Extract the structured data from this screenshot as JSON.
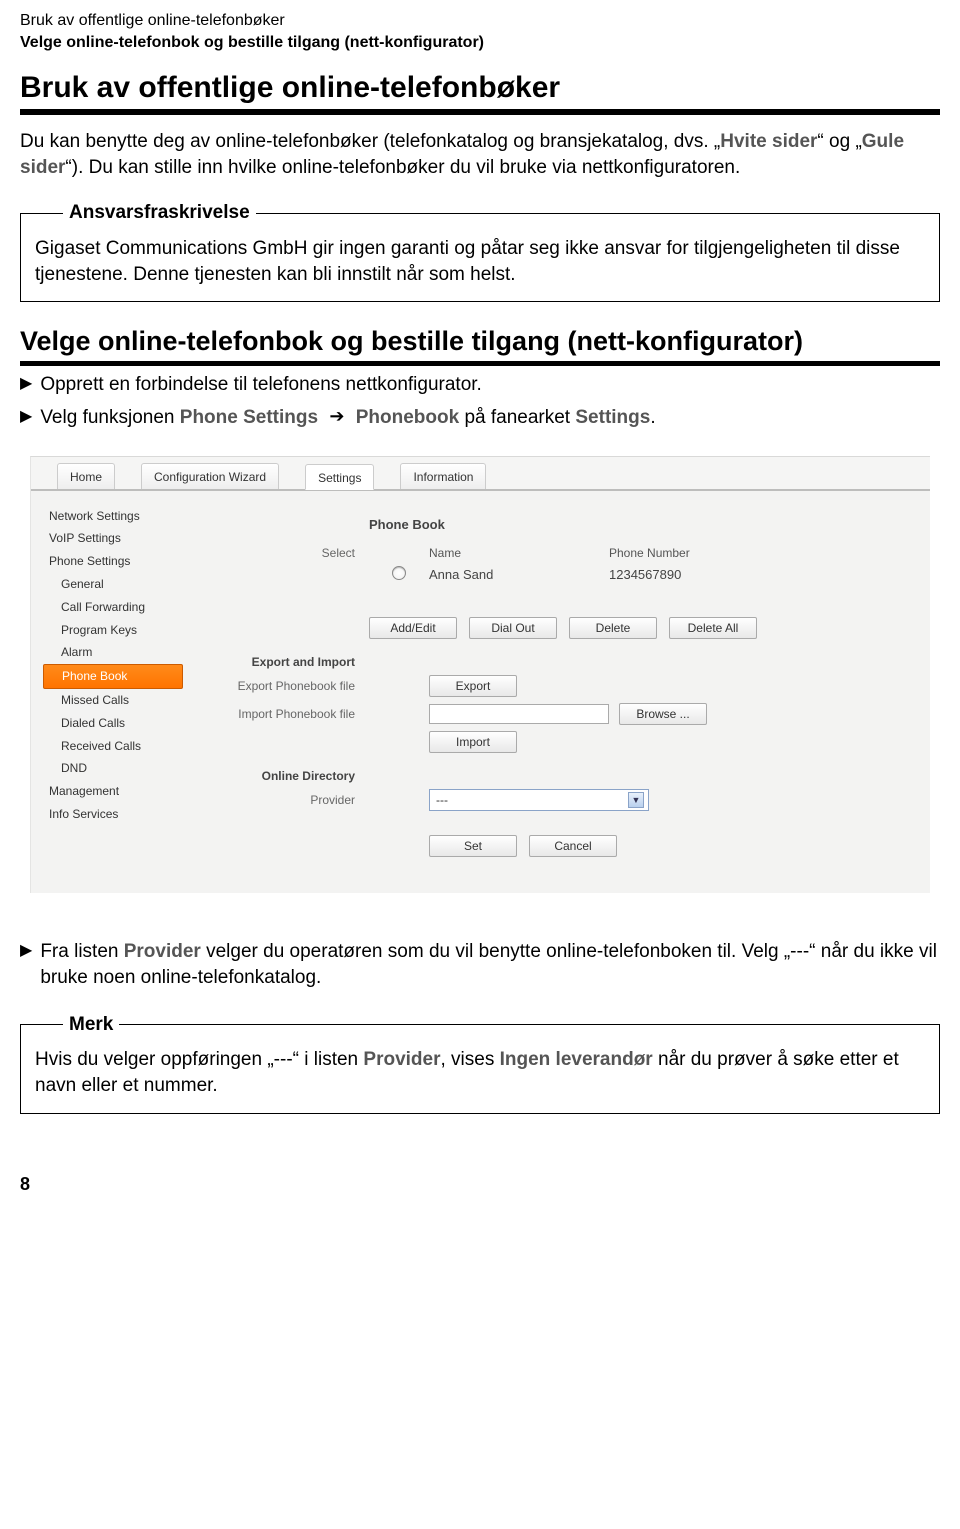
{
  "header": {
    "line1": "Bruk av offentlige online-telefonbøker",
    "line2": "Velge online-telefonbok og bestille tilgang (nett-konfigurator)"
  },
  "title": "Bruk av offentlige online-telefonbøker",
  "intro": {
    "p1a": "Du kan benytte deg av online-telefonbøker (telefonkatalog og bransjekatalog, dvs. „",
    "p1_hvite": "Hvite sider",
    "p1b": "“ og „",
    "p1_gule": "Gule sider",
    "p1c": "“). Du kan stille inn hvilke online-telefonbøker du vil bruke via nettkonfiguratoren."
  },
  "disclaimer": {
    "legend": "Ansvarsfraskrivelse",
    "text": "Gigaset Communications GmbH gir ingen garanti og påtar seg ikke ansvar for tilgjengeligheten til disse tjenestene. Denne tjenesten kan bli innstilt når som helst."
  },
  "subtitle": "Velge online-telefonbok og bestille tilgang (nett-konfigurator)",
  "steps": {
    "s1": "Opprett en forbindelse til telefonens nettkonfigurator.",
    "s2a": "Velg funksjonen ",
    "s2_phone": "Phone Settings",
    "s2_arrow": "➔",
    "s2_pb": "Phonebook",
    "s2b": " på fanearket ",
    "s2_settings": "Settings",
    "s2c": "."
  },
  "ui": {
    "tabs": {
      "home": "Home",
      "wizard": "Configuration Wizard",
      "settings": "Settings",
      "info": "Information"
    },
    "sidebar": {
      "network": "Network Settings",
      "voip": "VoIP Settings",
      "phone": "Phone Settings",
      "general": "General",
      "callfw": "Call Forwarding",
      "progkeys": "Program Keys",
      "alarm": "Alarm",
      "phonebook": "Phone Book",
      "missed": "Missed Calls",
      "dialed": "Dialed Calls",
      "received": "Received Calls",
      "dnd": "DND",
      "management": "Management",
      "infoservices": "Info Services"
    },
    "content": {
      "pbTitle": "Phone Book",
      "selectLabel": "Select",
      "nameHead": "Name",
      "numHead": "Phone Number",
      "sampleName": "Anna Sand",
      "sampleNum": "1234567890",
      "addEdit": "Add/Edit",
      "dialOut": "Dial Out",
      "delete": "Delete",
      "deleteAll": "Delete All",
      "exportImport": "Export and Import",
      "exportLabel": "Export Phonebook file",
      "exportBtn": "Export",
      "importLabel": "Import Phonebook file",
      "browseBtn": "Browse ...",
      "importBtn": "Import",
      "onlineDir": "Online Directory",
      "providerLabel": "Provider",
      "providerValue": "---",
      "setBtn": "Set",
      "cancelBtn": "Cancel"
    }
  },
  "afterSteps": {
    "b1a": "Fra listen ",
    "b1_prov": "Provider",
    "b1b": " velger du operatøren som du vil benytte online-telefonboken til. Velg „---“ når du ikke vil bruke noen online-telefonkatalog."
  },
  "note": {
    "legend": "Merk",
    "text_a": "Hvis du velger oppføringen „---“ i listen ",
    "text_prov": "Provider",
    "text_b": ", vises ",
    "text_ing": "Ingen leverandør",
    "text_c": " når du prøver å søke etter et navn eller et nummer."
  },
  "pageNum": "8"
}
